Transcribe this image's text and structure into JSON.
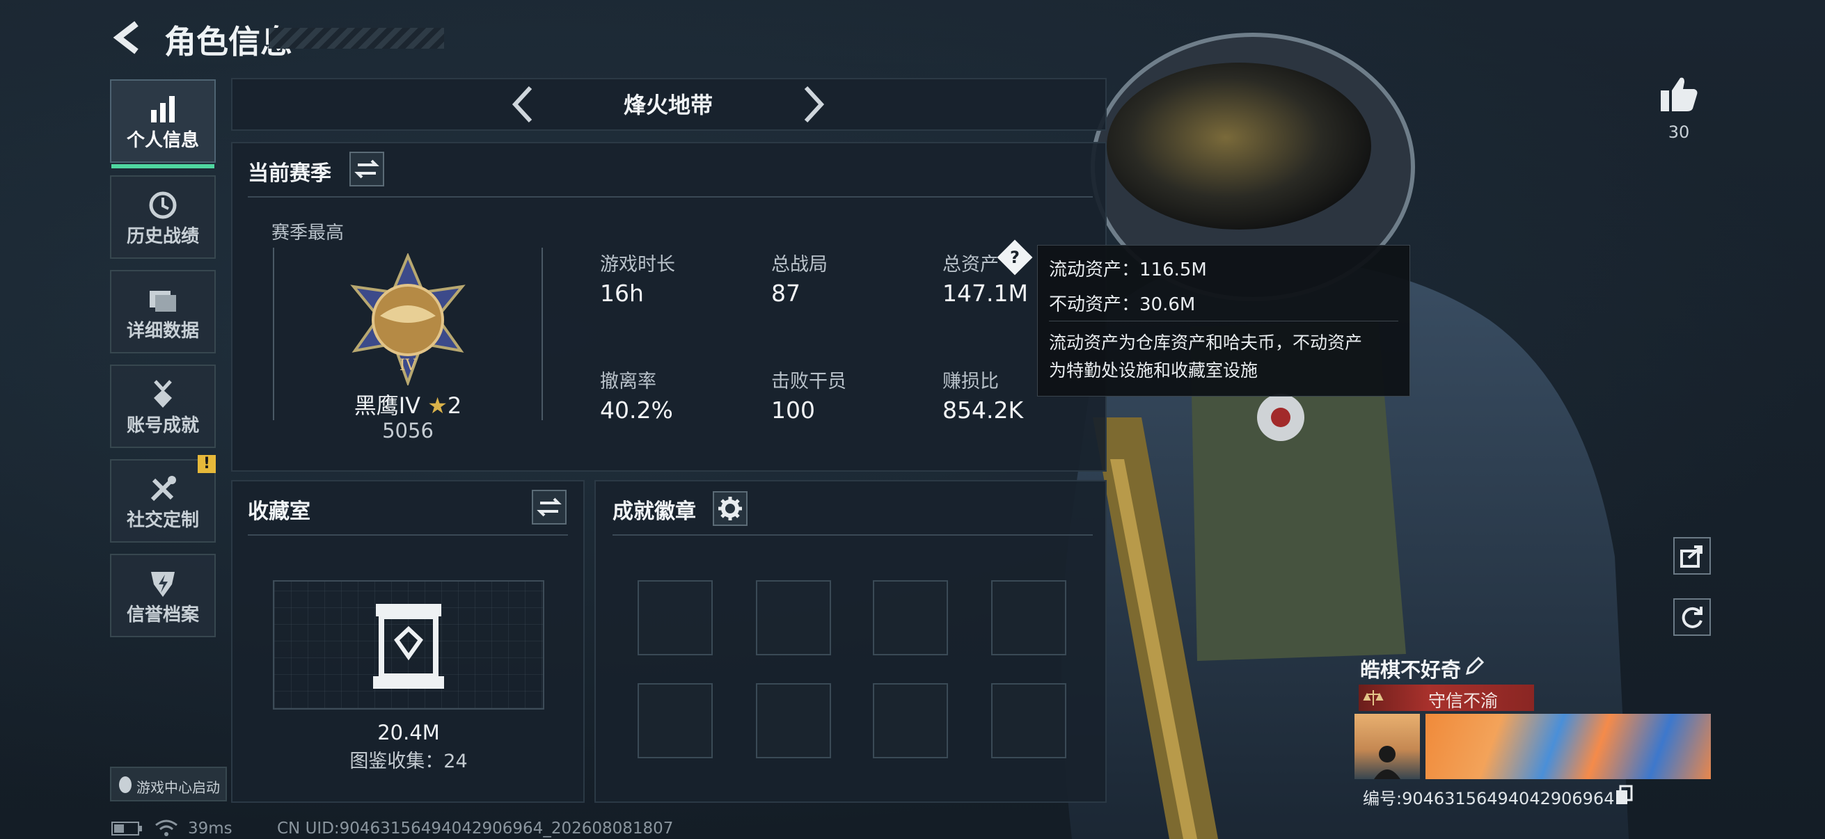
{
  "header": {
    "title": "角色信息"
  },
  "nav": {
    "items": [
      {
        "label": "个人信息",
        "icon": "bar-chart-icon"
      },
      {
        "label": "历史战绩",
        "icon": "history-icon"
      },
      {
        "label": "详细数据",
        "icon": "folder-icon"
      },
      {
        "label": "账号成就",
        "icon": "medal-icon"
      },
      {
        "label": "社交定制",
        "icon": "tools-icon"
      },
      {
        "label": "信誉档案",
        "icon": "shield-icon"
      }
    ],
    "footer_label": "游戏中心启动",
    "alert_badge": "!"
  },
  "mode_selector": {
    "label": "烽火地带"
  },
  "season": {
    "title": "当前赛季",
    "best_label": "赛季最高",
    "rank_name": "黑鹰IV",
    "rank_stars": "2",
    "rank_points": "5056",
    "stats": [
      {
        "label": "游戏时长",
        "value": "16h"
      },
      {
        "label": "总战局",
        "value": "87"
      },
      {
        "label": "总资产",
        "value": "147.1M"
      },
      {
        "label": "撤离率",
        "value": "40.2%"
      },
      {
        "label": "击败干员",
        "value": "100"
      },
      {
        "label": "赚损比",
        "value": "854.2K"
      }
    ]
  },
  "tooltip": {
    "line1": "流动资产：116.5M",
    "line2": "不动资产：30.6M",
    "desc1": "流动资产为仓库资产和哈夫币，不动资产",
    "desc2": "为特勤处设施和收藏室设施"
  },
  "collection": {
    "title": "收藏室",
    "value": "20.4M",
    "count_text": "图鉴收集：24"
  },
  "achievements": {
    "title": "成就徽章"
  },
  "player": {
    "name": "皓棋不好奇",
    "title_badge": "守信不渝",
    "id_text": "编号:9046315649404290696​4"
  },
  "likes": {
    "count": "30"
  },
  "status_bar": {
    "ping": "39ms",
    "uid": "CN UID:90463156494042906964_202608081807"
  },
  "colors": {
    "accent_green": "#4fd6a0",
    "title_badge_red": "#a8312c",
    "alert_yellow": "#e7b93a"
  }
}
